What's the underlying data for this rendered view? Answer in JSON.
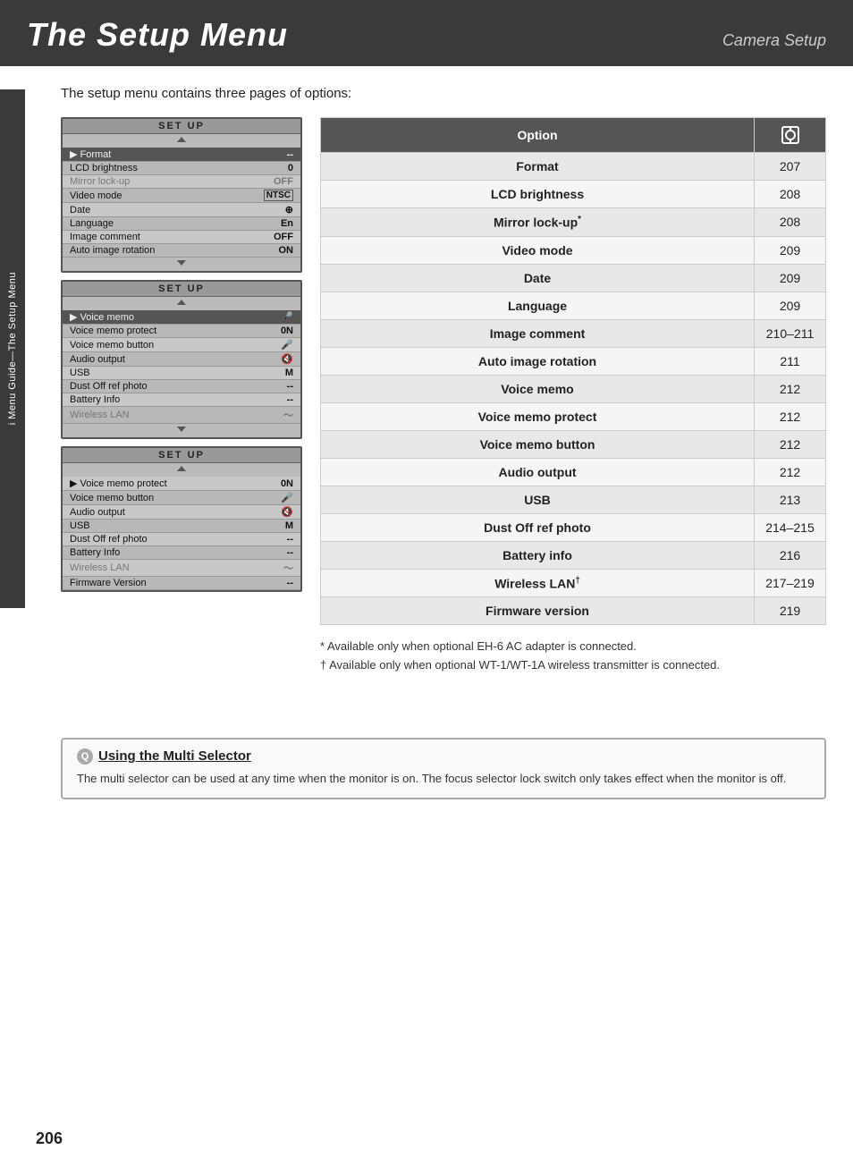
{
  "header": {
    "title": "The Setup Menu",
    "subtitle": "Camera Setup"
  },
  "intro": "The setup menu contains three pages of options:",
  "side_tab": {
    "icon": "🔧",
    "label": "i Menu Guide—The Setup Menu"
  },
  "lcd_screens": [
    {
      "id": "screen1",
      "header": "SET  UP",
      "rows": [
        {
          "label": "Format",
          "value": "--",
          "selected": true
        },
        {
          "label": "LCD brightness",
          "value": "0",
          "selected": false
        },
        {
          "label": "Mirror lock-up",
          "value": "OFF",
          "selected": false,
          "dim": true
        },
        {
          "label": "Video mode",
          "value": "NTSC",
          "selected": false
        },
        {
          "label": "Date",
          "value": "⊕",
          "selected": false
        },
        {
          "label": "Language",
          "value": "En",
          "selected": false
        },
        {
          "label": "Image comment",
          "value": "OFF",
          "selected": false
        },
        {
          "label": "Auto image rotation",
          "value": "ON",
          "selected": false
        }
      ]
    },
    {
      "id": "screen2",
      "header": "SET  UP",
      "rows": [
        {
          "label": "Voice memo",
          "value": "🎤",
          "selected": true
        },
        {
          "label": "Voice memo protect",
          "value": "0N",
          "selected": false
        },
        {
          "label": "Voice memo button",
          "value": "🎤",
          "selected": false
        },
        {
          "label": "Audio output",
          "value": "🔇",
          "selected": false
        },
        {
          "label": "USB",
          "value": "M",
          "selected": false
        },
        {
          "label": "Dust Off ref photo",
          "value": "--",
          "selected": false
        },
        {
          "label": "Battery Info",
          "value": "--",
          "selected": false
        },
        {
          "label": "Wireless LAN",
          "value": "〜",
          "selected": false,
          "dim": true
        }
      ]
    },
    {
      "id": "screen3",
      "header": "SET  UP",
      "rows": [
        {
          "label": "Voice memo protect",
          "value": "0N",
          "selected": false
        },
        {
          "label": "Voice memo button",
          "value": "🎤",
          "selected": false
        },
        {
          "label": "Audio output",
          "value": "🔇",
          "selected": false
        },
        {
          "label": "USB",
          "value": "M",
          "selected": false
        },
        {
          "label": "Dust Off ref photo",
          "value": "--",
          "selected": false
        },
        {
          "label": "Battery Info",
          "value": "--",
          "selected": false
        },
        {
          "label": "Wireless LAN",
          "value": "〜",
          "selected": false,
          "dim": true
        },
        {
          "label": "Firmware Version",
          "value": "--",
          "selected": false
        }
      ]
    }
  ],
  "table": {
    "headers": [
      "Option",
      "📷"
    ],
    "rows": [
      {
        "option": "Format",
        "page": "207"
      },
      {
        "option": "LCD brightness",
        "page": "208"
      },
      {
        "option": "Mirror lock-up*",
        "page": "208"
      },
      {
        "option": "Video mode",
        "page": "209"
      },
      {
        "option": "Date",
        "page": "209"
      },
      {
        "option": "Language",
        "page": "209"
      },
      {
        "option": "Image comment",
        "page": "210–211"
      },
      {
        "option": "Auto image rotation",
        "page": "211"
      },
      {
        "option": "Voice memo",
        "page": "212"
      },
      {
        "option": "Voice memo protect",
        "page": "212"
      },
      {
        "option": "Voice memo button",
        "page": "212"
      },
      {
        "option": "Audio output",
        "page": "212"
      },
      {
        "option": "USB",
        "page": "213"
      },
      {
        "option": "Dust Off ref photo",
        "page": "214–215"
      },
      {
        "option": "Battery info",
        "page": "216"
      },
      {
        "option": "Wireless LAN†",
        "page": "217–219"
      },
      {
        "option": "Firmware version",
        "page": "219"
      }
    ]
  },
  "footnotes": [
    "* Available only when optional EH-6 AC adapter is connected.",
    "† Available only when optional WT-1/WT-1A wireless transmitter is connected."
  ],
  "bottom_note": {
    "icon": "Q",
    "title": "Using the Multi Selector",
    "text": "The multi selector can be used at any time when the monitor is on.  The focus selector lock switch only takes effect when the monitor is off."
  },
  "page_number": "206"
}
